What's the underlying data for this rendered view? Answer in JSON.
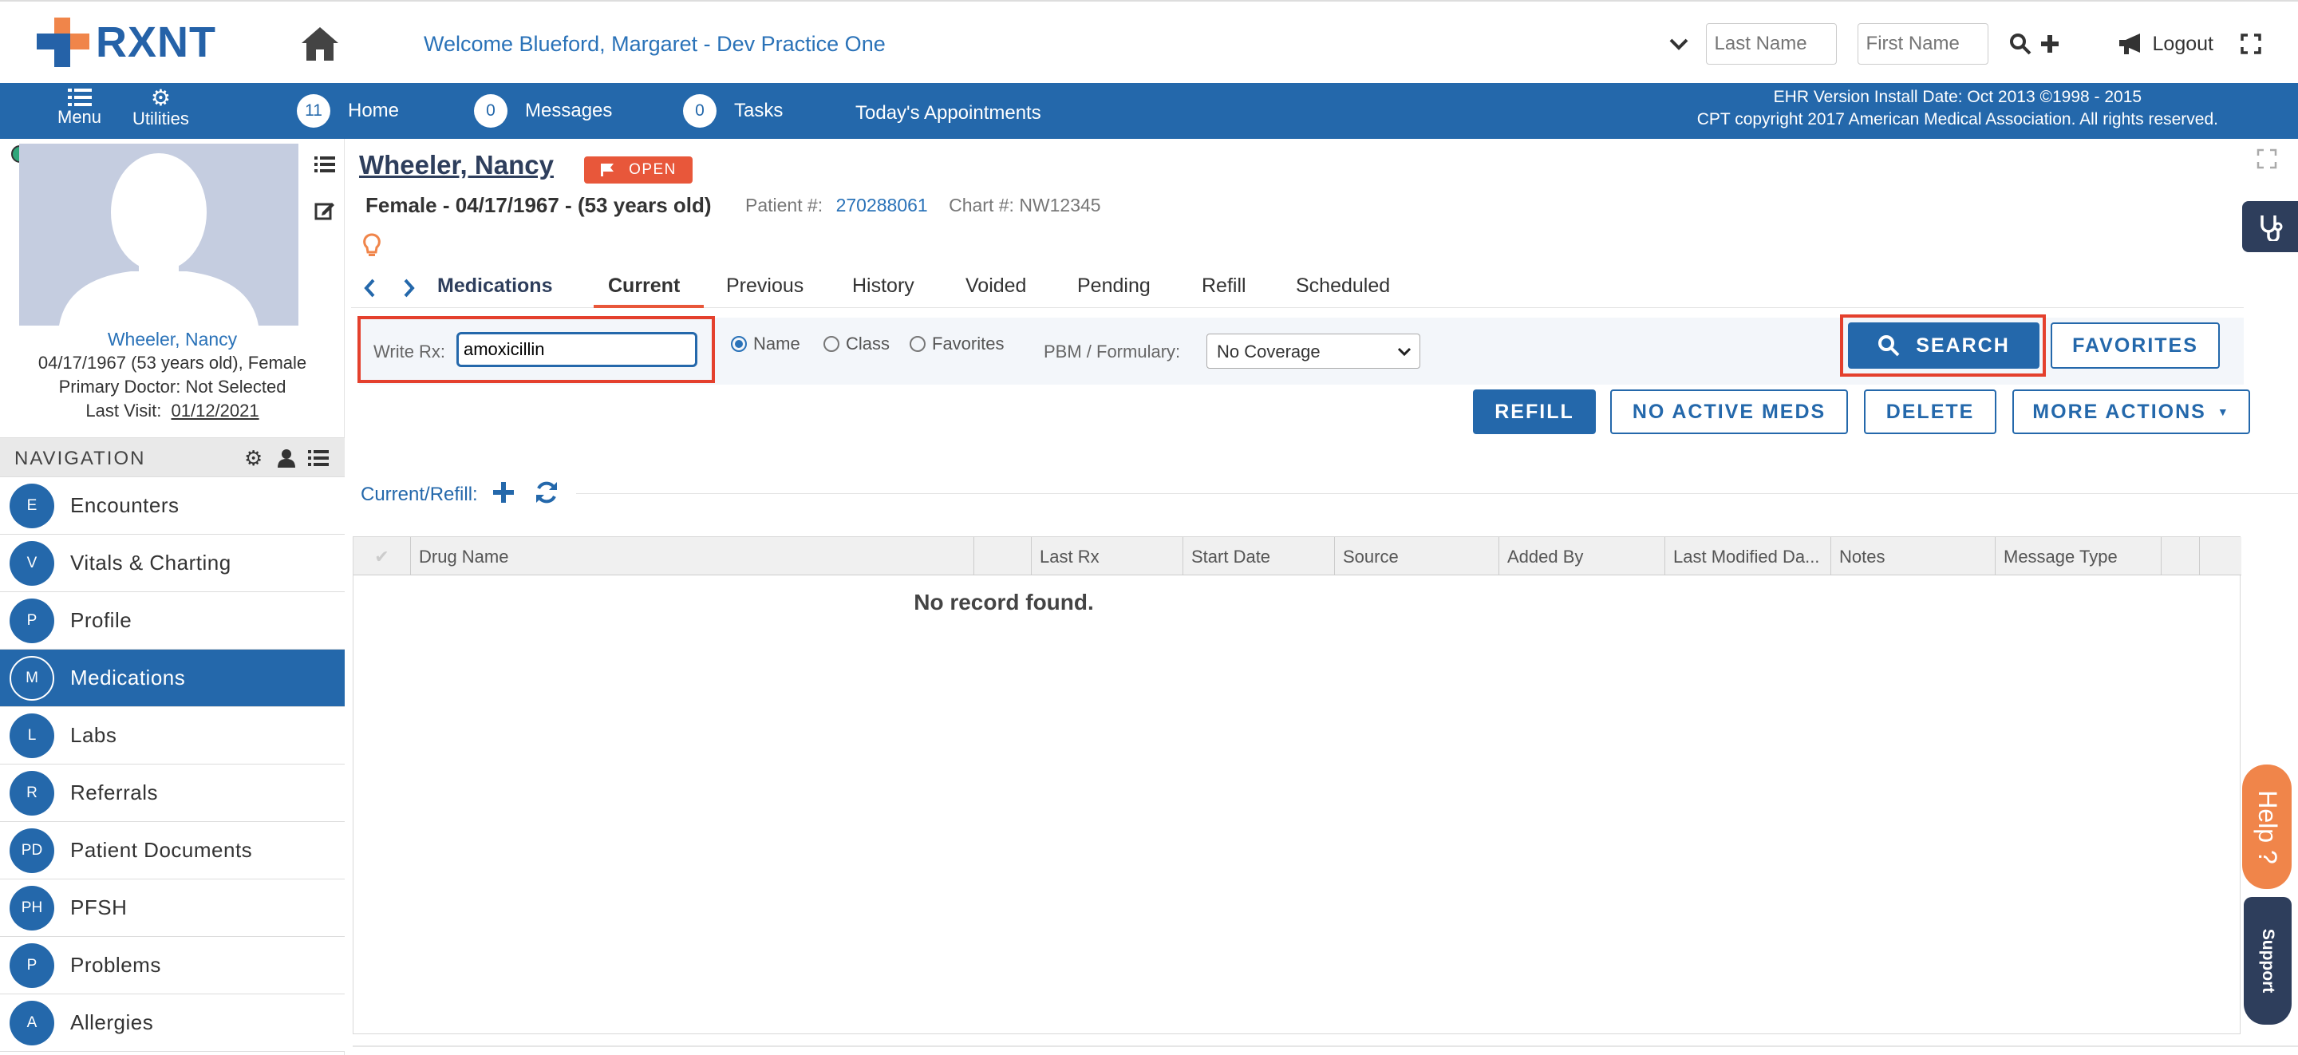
{
  "brand": {
    "name": "RXNT"
  },
  "header": {
    "welcome": "Welcome  Blueford, Margaret - Dev Practice One",
    "last_name_placeholder": "Last Name",
    "first_name_placeholder": "First Name",
    "logout": "Logout"
  },
  "navbar": {
    "menu": "Menu",
    "utilities": "Utilities",
    "home_count": "11",
    "home": "Home",
    "messages_count": "0",
    "messages": "Messages",
    "tasks_count": "0",
    "tasks": "Tasks",
    "appointments": "Today's Appointments",
    "ehr_line1": "EHR Version Install Date: Oct 2013 ©1998 - 2015",
    "ehr_line2": "CPT copyright 2017 American Medical Association. All rights reserved."
  },
  "patient": {
    "name": "Wheeler, Nancy",
    "status": "OPEN",
    "demographics": "Female - 04/17/1967 - (53 years old)",
    "patient_num_label": "Patient #:",
    "patient_num": "270288061",
    "chart_label": "Chart #:",
    "chart_num": "NW12345",
    "card_name": "Wheeler, Nancy",
    "card_dob": "04/17/1967 (53 years old), Female",
    "primary_doctor": "Primary Doctor: Not Selected",
    "last_visit_label": "Last Visit:",
    "last_visit": "01/12/2021"
  },
  "navigation": {
    "title": "NAVIGATION",
    "items": [
      {
        "abbr": "E",
        "label": "Encounters"
      },
      {
        "abbr": "V",
        "label": "Vitals & Charting"
      },
      {
        "abbr": "P",
        "label": "Profile"
      },
      {
        "abbr": "M",
        "label": "Medications"
      },
      {
        "abbr": "L",
        "label": "Labs"
      },
      {
        "abbr": "R",
        "label": "Referrals"
      },
      {
        "abbr": "PD",
        "label": "Patient Documents"
      },
      {
        "abbr": "PH",
        "label": "PFSH"
      },
      {
        "abbr": "P",
        "label": "Problems"
      },
      {
        "abbr": "A",
        "label": "Allergies"
      }
    ],
    "active_index": 3
  },
  "tabs": {
    "section": "Medications",
    "items": [
      "Current",
      "Previous",
      "History",
      "Voided",
      "Pending",
      "Refill",
      "Scheduled"
    ],
    "active": "Current"
  },
  "search": {
    "write_rx_label": "Write Rx:",
    "write_rx_value": "amoxicillin",
    "radio_name": "Name",
    "radio_class": "Class",
    "radio_favorites": "Favorites",
    "radio_selected": "Name",
    "pbm_label": "PBM / Formulary:",
    "pbm_value": "No Coverage",
    "search_button": "SEARCH",
    "favorites_button": "FAVORITES"
  },
  "actions": {
    "refill": "REFILL",
    "no_active": "NO ACTIVE MEDS",
    "delete": "DELETE",
    "more": "MORE ACTIONS"
  },
  "grid": {
    "title": "Current/Refill:",
    "columns": [
      "Drug Name",
      "",
      "Last Rx",
      "Start Date",
      "Source",
      "Added By",
      "Last Modified Da...",
      "Notes",
      "Message Type"
    ],
    "empty_message": "No record found."
  },
  "widgets": {
    "help": "Help",
    "support": "Support"
  },
  "colors": {
    "primary": "#2468ab",
    "accent": "#e8573a",
    "highlight_box": "#e4402d"
  }
}
